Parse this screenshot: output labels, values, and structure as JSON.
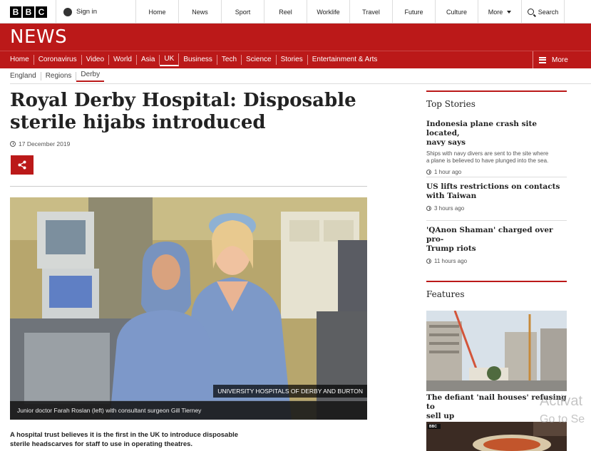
{
  "brand": {
    "letters": [
      "B",
      "B",
      "C"
    ],
    "section_title": "NEWS"
  },
  "topbar": {
    "signin_label": "Sign in",
    "nav": [
      "Home",
      "News",
      "Sport",
      "Reel",
      "Worklife",
      "Travel",
      "Future",
      "Culture"
    ],
    "more_label": "More",
    "search_label": "Search"
  },
  "section_nav": {
    "items": [
      "Home",
      "Coronavirus",
      "Video",
      "World",
      "Asia",
      "UK",
      "Business",
      "Tech",
      "Science",
      "Stories",
      "Entertainment & Arts"
    ],
    "active": "UK",
    "more_label": "More"
  },
  "breadcrumb": [
    "England",
    "Regions",
    "Derby"
  ],
  "article": {
    "headline_line1": "Royal Derby Hospital: Disposable",
    "headline_line2": "sterile hijabs introduced",
    "date": "17 December 2019",
    "photo_credit": "UNIVERSITY HOSPITALS OF DERBY AND BURTON",
    "caption": "Junior doctor Farah Roslan (left) with consultant surgeon Gill Tierney",
    "summary_line1": "A hospital trust believes it is the first in the UK to introduce disposable",
    "summary_line2": "sterile headscarves for staff to use in operating theatres."
  },
  "top_stories": {
    "heading": "Top Stories",
    "items": [
      {
        "title_line1": "Indonesia plane crash site located,",
        "title_line2": "navy says",
        "summary_line1": "Ships with navy divers are sent to the site where",
        "summary_line2": "a plane is believed to have plunged into the sea.",
        "time": "1 hour ago"
      },
      {
        "title_line1": "US lifts restrictions on contacts",
        "title_line2": "with Taiwan",
        "time": "3 hours ago"
      },
      {
        "title_line1": "'QAnon Shaman' charged over pro-",
        "title_line2": "Trump riots",
        "time": "11 hours ago"
      }
    ]
  },
  "features": {
    "heading": "Features",
    "item1_title_line1": "The defiant 'nail houses' refusing to",
    "item1_title_line2": "sell up",
    "item2_badge": "BBC"
  },
  "watermark": {
    "line1": "Activat",
    "line2": "Go to Se"
  },
  "colors": {
    "accent": "#bb1919",
    "text": "#222222"
  }
}
